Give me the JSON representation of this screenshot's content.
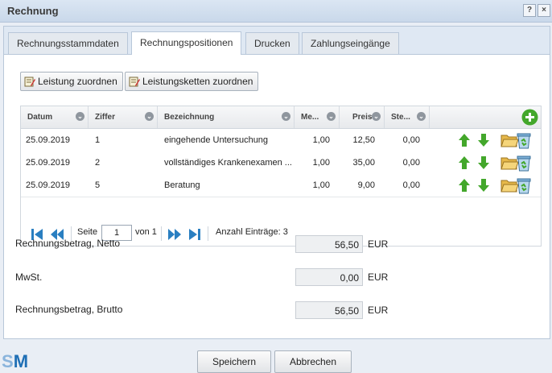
{
  "window": {
    "title": "Rechnung",
    "help": "?",
    "close": "×"
  },
  "tabs": [
    {
      "label": "Rechnungsstammdaten"
    },
    {
      "label": "Rechnungspositionen"
    },
    {
      "label": "Drucken"
    },
    {
      "label": "Zahlungseingänge"
    }
  ],
  "toolbar": {
    "assign_service": "Leistung zuordnen",
    "assign_chain": "Leistungsketten zuordnen"
  },
  "grid": {
    "columns": [
      "Datum",
      "Ziffer",
      "Bezeichnung",
      "Me...",
      "Preis",
      "Ste..."
    ],
    "rows": [
      {
        "datum": "25.09.2019",
        "ziffer": "1",
        "bezeichnung": "eingehende Untersuchung",
        "menge": "1,00",
        "preis": "12,50",
        "steuer": "0,00"
      },
      {
        "datum": "25.09.2019",
        "ziffer": "2",
        "bezeichnung": "vollständiges Krankenexamen ...",
        "menge": "1,00",
        "preis": "35,00",
        "steuer": "0,00"
      },
      {
        "datum": "25.09.2019",
        "ziffer": "5",
        "bezeichnung": "Beratung",
        "menge": "1,00",
        "preis": "9,00",
        "steuer": "0,00"
      }
    ]
  },
  "pager": {
    "page_label": "Seite",
    "page": "1",
    "of_label": "von 1",
    "count_label": "Anzahl Einträge: 3"
  },
  "summary": {
    "netto_label": "Rechnungsbetrag, Netto",
    "netto_value": "56,50",
    "mwst_label": "MwSt.",
    "mwst_value": "0,00",
    "brutto_label": "Rechnungsbetrag, Brutto",
    "brutto_value": "56,50",
    "currency": "EUR"
  },
  "footer": {
    "logo_s": "S",
    "logo_m": "M",
    "save": "Speichern",
    "cancel": "Abbrechen"
  },
  "colors": {
    "accent": "#2a7fc1",
    "green": "#43a72b",
    "logo_s": "#8ab4dc",
    "logo_m": "#1f6fb5"
  }
}
